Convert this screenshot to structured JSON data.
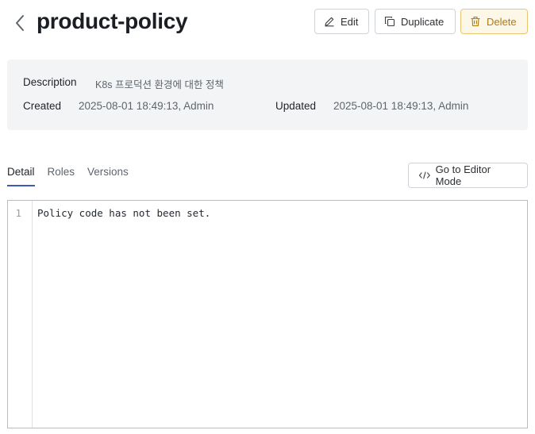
{
  "header": {
    "title": "product-policy",
    "edit_label": "Edit",
    "duplicate_label": "Duplicate",
    "delete_label": "Delete"
  },
  "info": {
    "description_label": "Description",
    "description_value": "K8s 프로덕션 환경에 대한 정책",
    "created_label": "Created",
    "created_value": "2025-08-01 18:49:13, Admin",
    "updated_label": "Updated",
    "updated_value": "2025-08-01 18:49:13, Admin"
  },
  "tabs": [
    {
      "label": "Detail",
      "active": true
    },
    {
      "label": "Roles",
      "active": false
    },
    {
      "label": "Versions",
      "active": false
    }
  ],
  "editor_mode_label": "Go to Editor Mode",
  "editor": {
    "line_numbers": [
      "1"
    ],
    "lines": [
      "Policy code has not been set."
    ]
  },
  "colors": {
    "delete_accent": "#b07a10",
    "delete_bg": "#fdf7e8",
    "active_tab_underline": "#3b5bb5",
    "info_panel_bg": "#f3f4f6"
  },
  "icons": {
    "back": "chevron-left-icon",
    "edit": "pencil-icon",
    "duplicate": "copy-icon",
    "delete": "trash-icon",
    "editor_mode": "code-icon"
  }
}
